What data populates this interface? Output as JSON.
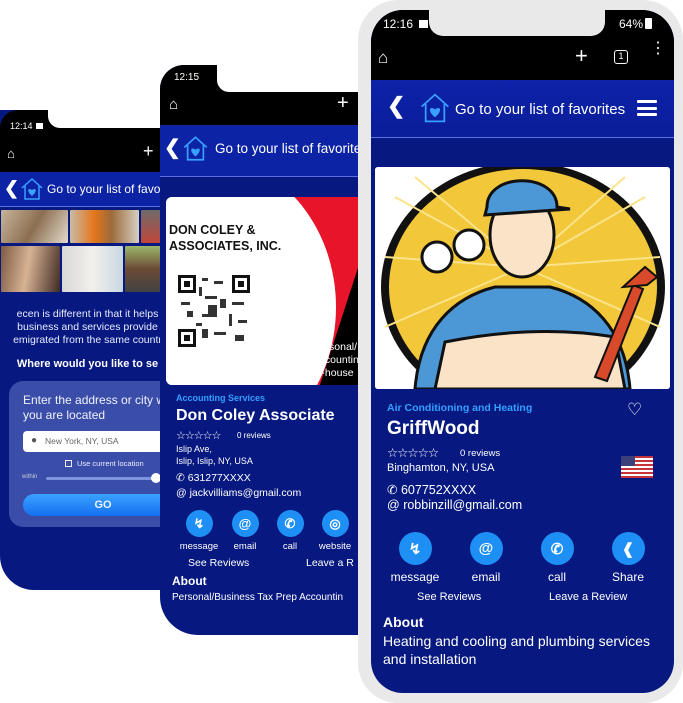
{
  "colors": {
    "navy": "#071880",
    "header_blue": "#0d23a6",
    "accent_blue": "#1e90f5",
    "category_blue": "#33a0ff",
    "frame_gray": "#e9e9e9"
  },
  "phone_left": {
    "status": {
      "time": "12:14"
    },
    "browser": {
      "home_icon": "home-icon",
      "new_tab_icon": "plus-icon"
    },
    "header": {
      "back_icon": "chevron-left-icon",
      "favorites_icon": "house-heart-icon",
      "title": "Go to your list of favor"
    },
    "photo_grid": [
      "people-cooking",
      "worker-orange-shirt",
      "shop-counter",
      "women-celebrating",
      "doctor-patient-tablet",
      "worker-overalls"
    ],
    "intro": {
      "line1": "ecen is different in that it helps",
      "line2": "business and services provide",
      "line3": "emigrated from the same countr"
    },
    "where_heading": "Where would you like to se",
    "search_card": {
      "label": "Enter the address or city w you are located",
      "input_placeholder": "New York, NY, USA",
      "location_icon": "map-pin-icon",
      "use_current_location": "Use current location",
      "within_label": "within",
      "radius_slider_value": 1.0,
      "go_button": "GO"
    }
  },
  "phone_middle": {
    "status": {
      "time": "12:15"
    },
    "browser": {
      "home_icon": "home-icon",
      "new_tab_icon": "plus-icon"
    },
    "header": {
      "back_icon": "chevron-left-icon",
      "favorites_icon": "house-heart-icon",
      "title": "Go to your list of favorite"
    },
    "business_card_image": {
      "company": "DON COLEY & ASSOCIATES, INC.",
      "bullets": [
        "•Personal/",
        "•Accountin",
        "•In-house"
      ]
    },
    "listing": {
      "category": "Accounting Services",
      "name": "Don Coley Associate",
      "rating_stars": "☆☆☆☆☆",
      "reviews": "0 reviews",
      "address_line1": "Islip Ave,",
      "address_line2": "Islip, Islip, NY, USA",
      "phone": "631277XXXX",
      "email": "jackvilliams@gmail.com"
    },
    "actions": [
      {
        "label": "message",
        "icon": "messenger-icon"
      },
      {
        "label": "email",
        "icon": "at-icon"
      },
      {
        "label": "call",
        "icon": "phone-icon"
      },
      {
        "label": "website",
        "icon": "globe-icon"
      }
    ],
    "see_reviews": "See Reviews",
    "leave_review": "Leave a R",
    "about_heading": "About",
    "about_text": "Personal/Business Tax Prep Accountin"
  },
  "phone_front": {
    "status": {
      "time": "12:16",
      "battery": "64%"
    },
    "browser": {
      "home_icon": "home-icon",
      "new_tab_icon": "plus-icon",
      "tab_count": "1",
      "menu_icon": "kebab-menu-icon"
    },
    "header": {
      "back_icon": "chevron-left-icon",
      "favorites_icon": "house-heart-icon",
      "title": "Go to your list of favorites",
      "menu_icon": "hamburger-icon"
    },
    "hero_image": "hvac-technician-illustration",
    "listing": {
      "category": "Air Conditioning and Heating",
      "name": "GriffWood",
      "rating_stars": "☆☆☆☆☆",
      "reviews": "0 reviews",
      "address": "Binghamton, NY, USA",
      "phone": "607752XXXX",
      "email": "robbinzill@gmail.com",
      "country_flag": "us-flag-icon"
    },
    "actions": [
      {
        "label": "message",
        "icon": "messenger-icon"
      },
      {
        "label": "email",
        "icon": "at-icon"
      },
      {
        "label": "call",
        "icon": "phone-icon"
      },
      {
        "label": "Share",
        "icon": "share-icon"
      }
    ],
    "see_reviews": "See Reviews",
    "leave_review": "Leave a Review",
    "about_heading": "About",
    "about_text": "Heating and cooling and plumbing services and installation"
  }
}
